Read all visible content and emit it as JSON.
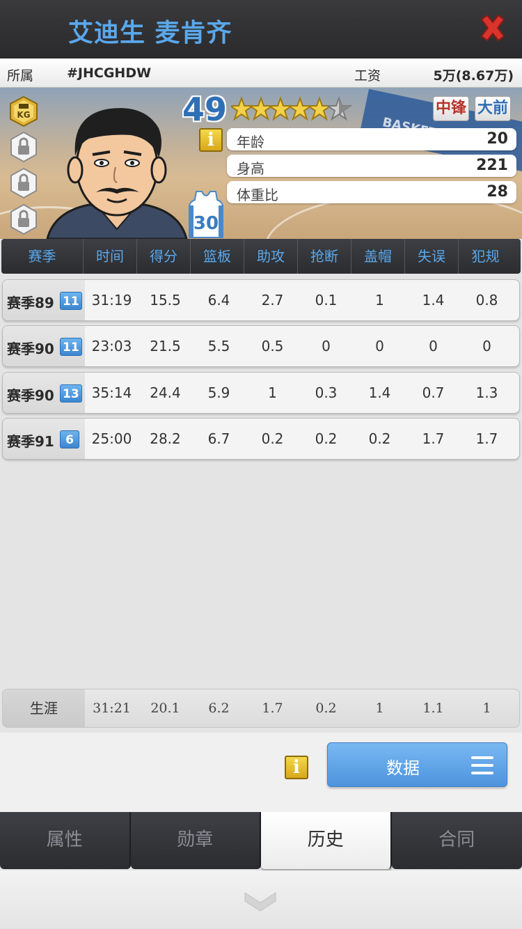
{
  "header": {
    "player_name": "艾迪生 麦肯齐",
    "close_icon": "close-x-icon"
  },
  "info": {
    "team_label": "所属",
    "team_value": "#JHCGHDW",
    "salary_label": "工资",
    "salary_value": "5万(8.67万)"
  },
  "player": {
    "rating": "49",
    "stars": 5.5,
    "position_main": "中锋",
    "position_sub": "大前",
    "jersey_number": "30",
    "badge_icon": "kg-badge-icon",
    "attributes": [
      {
        "label": "年龄",
        "value": "20"
      },
      {
        "label": "身高",
        "value": "221"
      },
      {
        "label": "体重比",
        "value": "28"
      }
    ],
    "background_text": "BASKETBALL CH"
  },
  "stats": {
    "headers": [
      "赛季",
      "时间",
      "得分",
      "篮板",
      "助攻",
      "抢断",
      "盖帽",
      "失误",
      "犯规"
    ],
    "rows": [
      {
        "season": "赛季89",
        "badge": "11",
        "values": [
          "31:19",
          "15.5",
          "6.4",
          "2.7",
          "0.1",
          "1",
          "1.4",
          "0.8"
        ]
      },
      {
        "season": "赛季90",
        "badge": "11",
        "values": [
          "23:03",
          "21.5",
          "5.5",
          "0.5",
          "0",
          "0",
          "0",
          "0"
        ]
      },
      {
        "season": "赛季90",
        "badge": "13",
        "values": [
          "35:14",
          "24.4",
          "5.9",
          "1",
          "0.3",
          "1.4",
          "0.7",
          "1.3"
        ]
      },
      {
        "season": "赛季91",
        "badge": "6",
        "values": [
          "25:00",
          "28.2",
          "6.7",
          "0.2",
          "0.2",
          "0.2",
          "1.7",
          "1.7"
        ]
      }
    ],
    "career": {
      "label": "生涯",
      "values": [
        "31:21",
        "20.1",
        "6.2",
        "1.7",
        "0.2",
        "1",
        "1.1",
        "1"
      ]
    }
  },
  "actions": {
    "info_icon": "i",
    "data_button": "数据"
  },
  "tabs": [
    {
      "label": "属性",
      "active": false
    },
    {
      "label": "勋章",
      "active": false
    },
    {
      "label": "历史",
      "active": true
    },
    {
      "label": "合同",
      "active": false
    }
  ],
  "colors": {
    "accent_blue": "#5aa8ec",
    "dark_bar": "#2a2c30",
    "position_red": "#b8332b",
    "button_blue": "#4d94de"
  }
}
